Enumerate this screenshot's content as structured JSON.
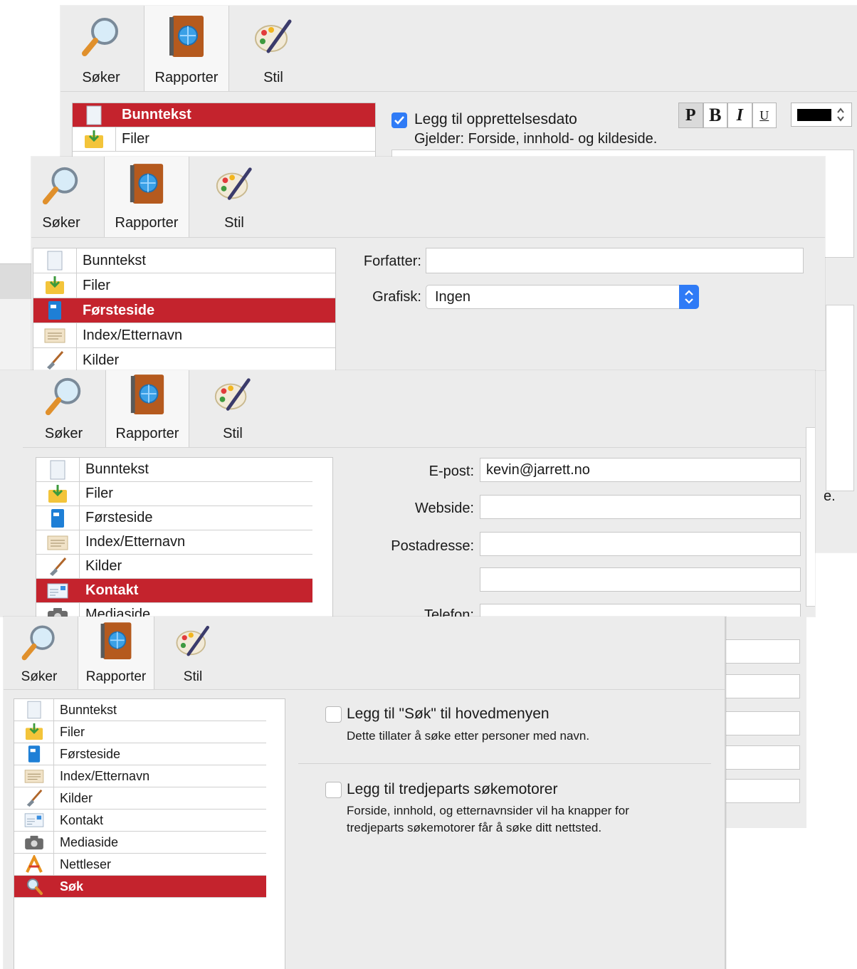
{
  "toolbar": {
    "search_label": "Søker",
    "reports_label": "Rapporter",
    "style_label": "Stil"
  },
  "sidebar_items": [
    {
      "label": "Bunntekst",
      "icon": "page-icon"
    },
    {
      "label": "Filer",
      "icon": "folder-download-icon"
    },
    {
      "label": "Førsteside",
      "icon": "book-blue-icon"
    },
    {
      "label": "Index/Etternavn",
      "icon": "index-card-icon"
    },
    {
      "label": "Kilder",
      "icon": "shovel-icon"
    },
    {
      "label": "Kontakt",
      "icon": "contact-card-icon"
    },
    {
      "label": "Mediaside",
      "icon": "camera-icon"
    },
    {
      "label": "Nettleser",
      "icon": "browser-icon"
    },
    {
      "label": "Søk",
      "icon": "magnifier-icon"
    }
  ],
  "panel1": {
    "checkbox_label": "Legg til opprettelsesdato",
    "checkbox_checked": true,
    "applies_text": "Gjelder: Forside, innhold- og kildeside.",
    "format_buttons": [
      "P",
      "B",
      "I",
      "U"
    ],
    "color_value": "#000000",
    "partial_right_text": "e.",
    "partial_right_char": ":"
  },
  "panel2": {
    "author_label": "Forfatter:",
    "author_value": "",
    "graphic_label": "Grafisk:",
    "graphic_value": "Ingen"
  },
  "panel3": {
    "email_label": "E-post:",
    "email_value": "kevin@jarrett.no",
    "website_label": "Webside:",
    "website_value": "",
    "address_label": "Postadresse:",
    "address_value": "",
    "address2_value": "",
    "phone_label": "Telefon:",
    "phone_value": ""
  },
  "panel4": {
    "search_menu_label": "Legg til \"Søk\" til hovedmenyen",
    "search_menu_desc": "Dette tillater å søke etter personer med navn.",
    "third_party_label": "Legg til tredjeparts søkemotorer",
    "third_party_desc_1": "Forside, innhold, og etternavnsider vil ha knapper for",
    "third_party_desc_2": "tredjeparts søkemotorer får å søke ditt nettsted."
  },
  "colors": {
    "selection": "#c4232d",
    "checkbox_on": "#2f7bf6",
    "panel_bg": "#ececec"
  }
}
